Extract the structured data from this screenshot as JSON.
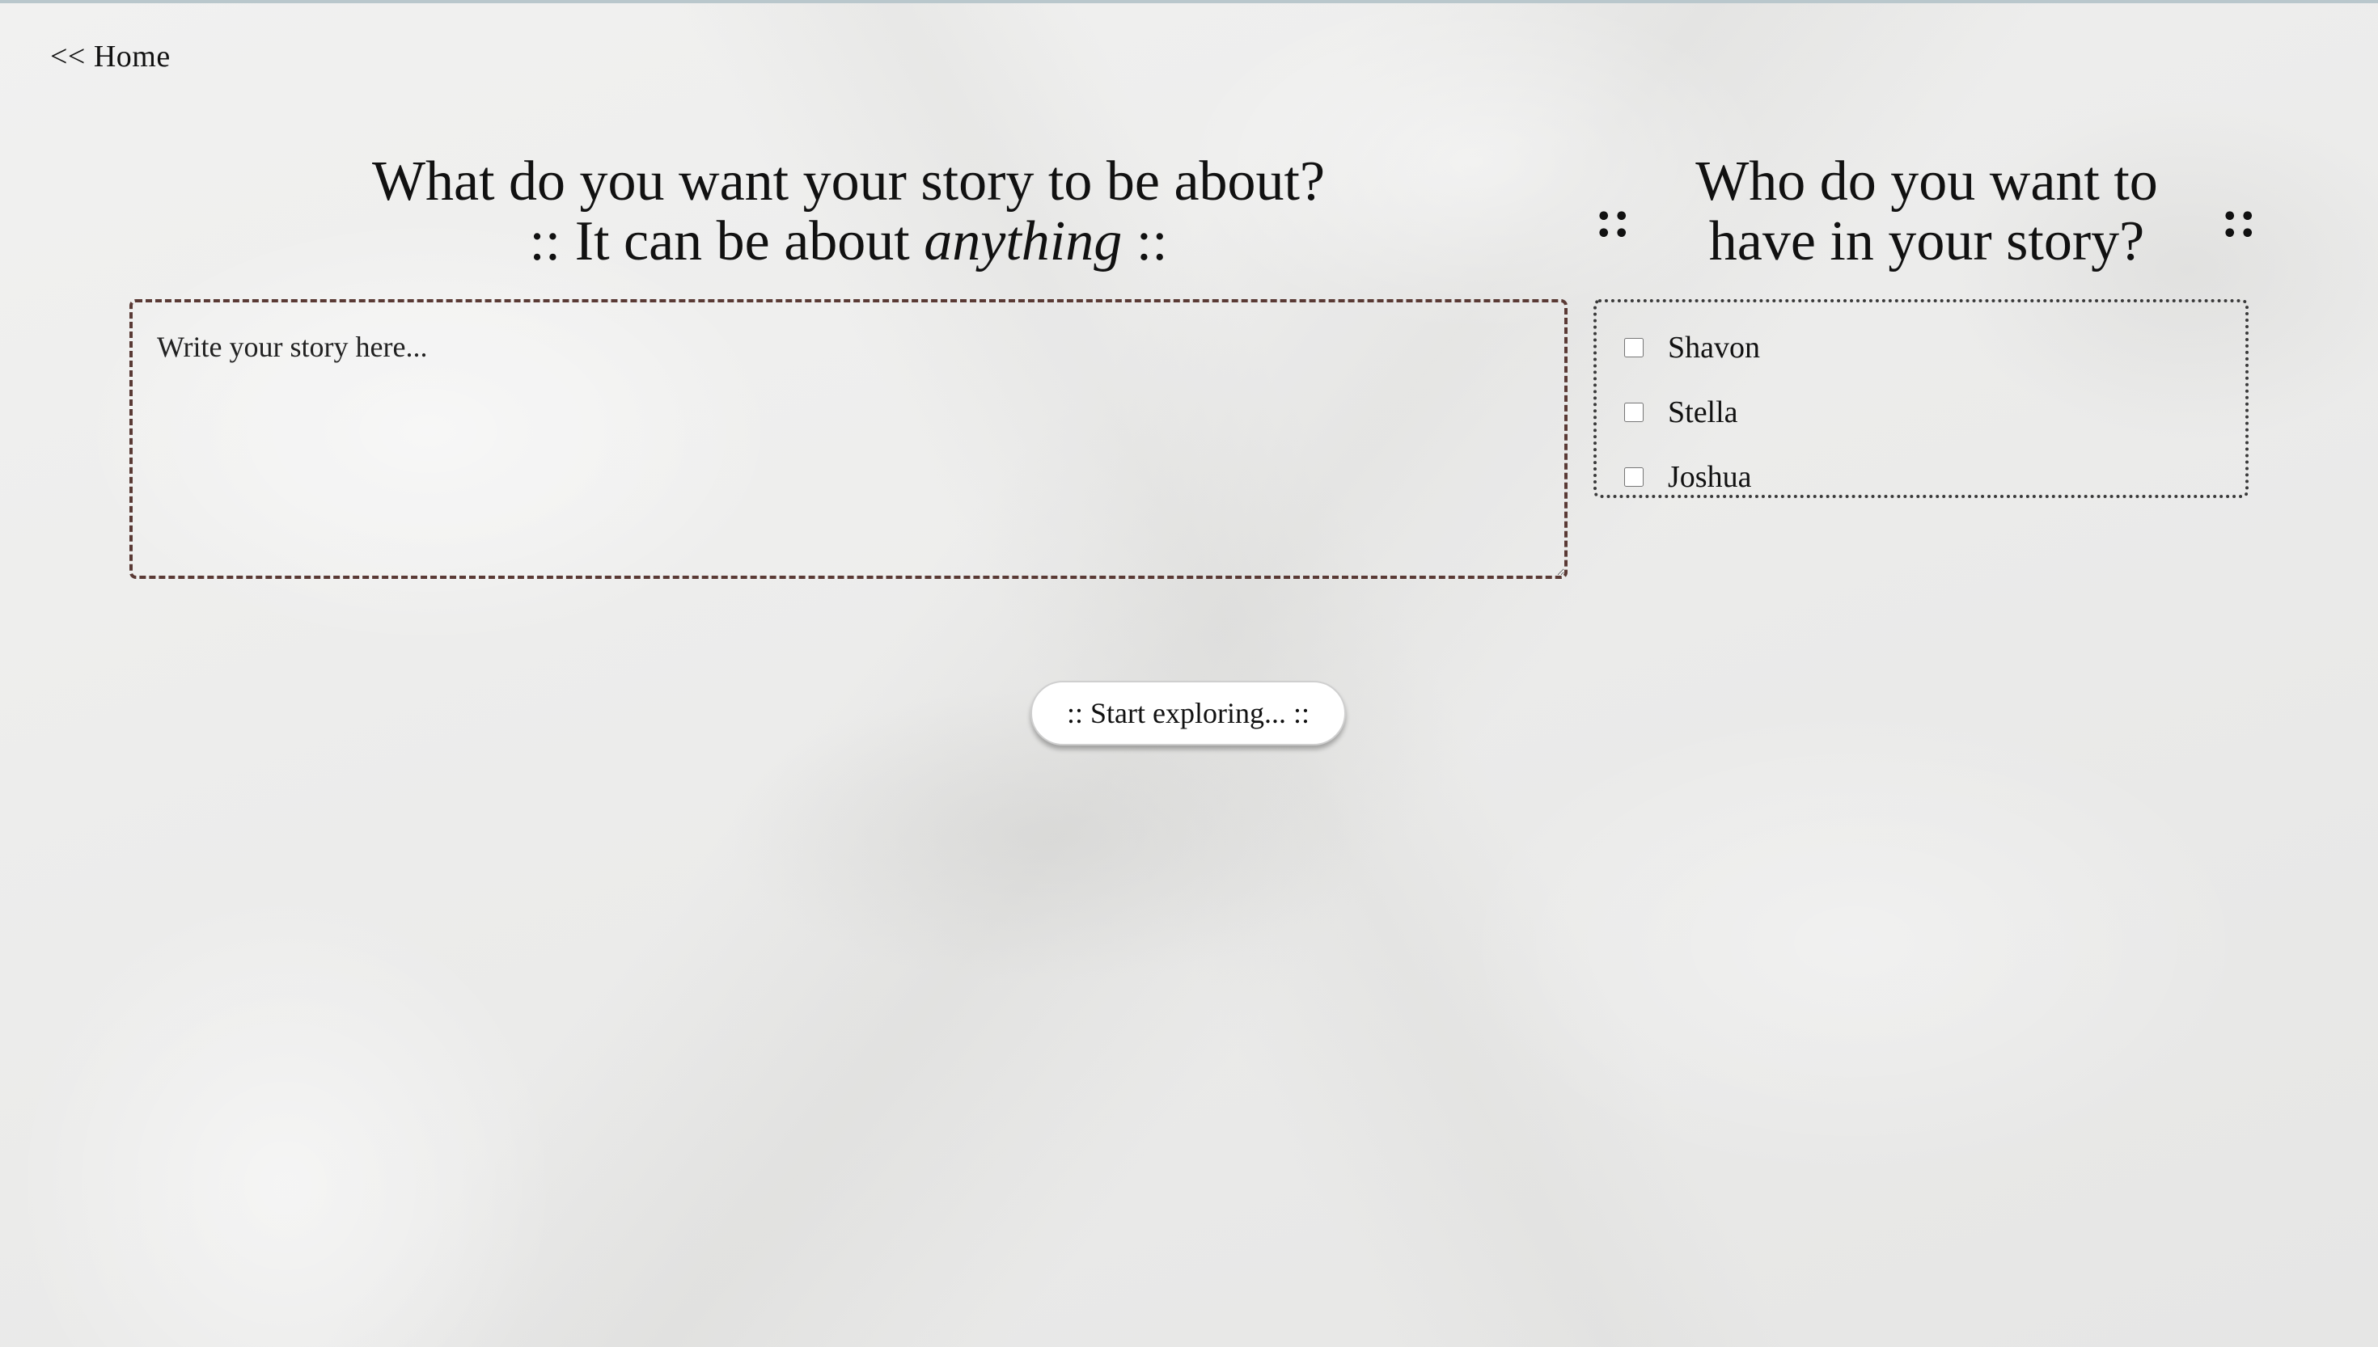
{
  "nav": {
    "home_label": "<< Home"
  },
  "story": {
    "title_line1": "What do you want your story to be about?",
    "title_line2_prefix": ":: It can be about ",
    "title_line2_emphasis": "anything",
    "title_line2_suffix": " ::",
    "placeholder": "Write your story here..."
  },
  "characters": {
    "title": "Who do you want to have in your story?",
    "decoration": "::",
    "items": [
      {
        "label": "Shavon",
        "checked": false
      },
      {
        "label": "Stella",
        "checked": false
      },
      {
        "label": "Joshua",
        "checked": false
      }
    ]
  },
  "actions": {
    "start_label": ":: Start exploring... ::"
  },
  "colors": {
    "text": "#111111",
    "textarea_border": "#5a3a35",
    "character_box_border": "#3a3a3a",
    "button_background": "#ffffff"
  }
}
